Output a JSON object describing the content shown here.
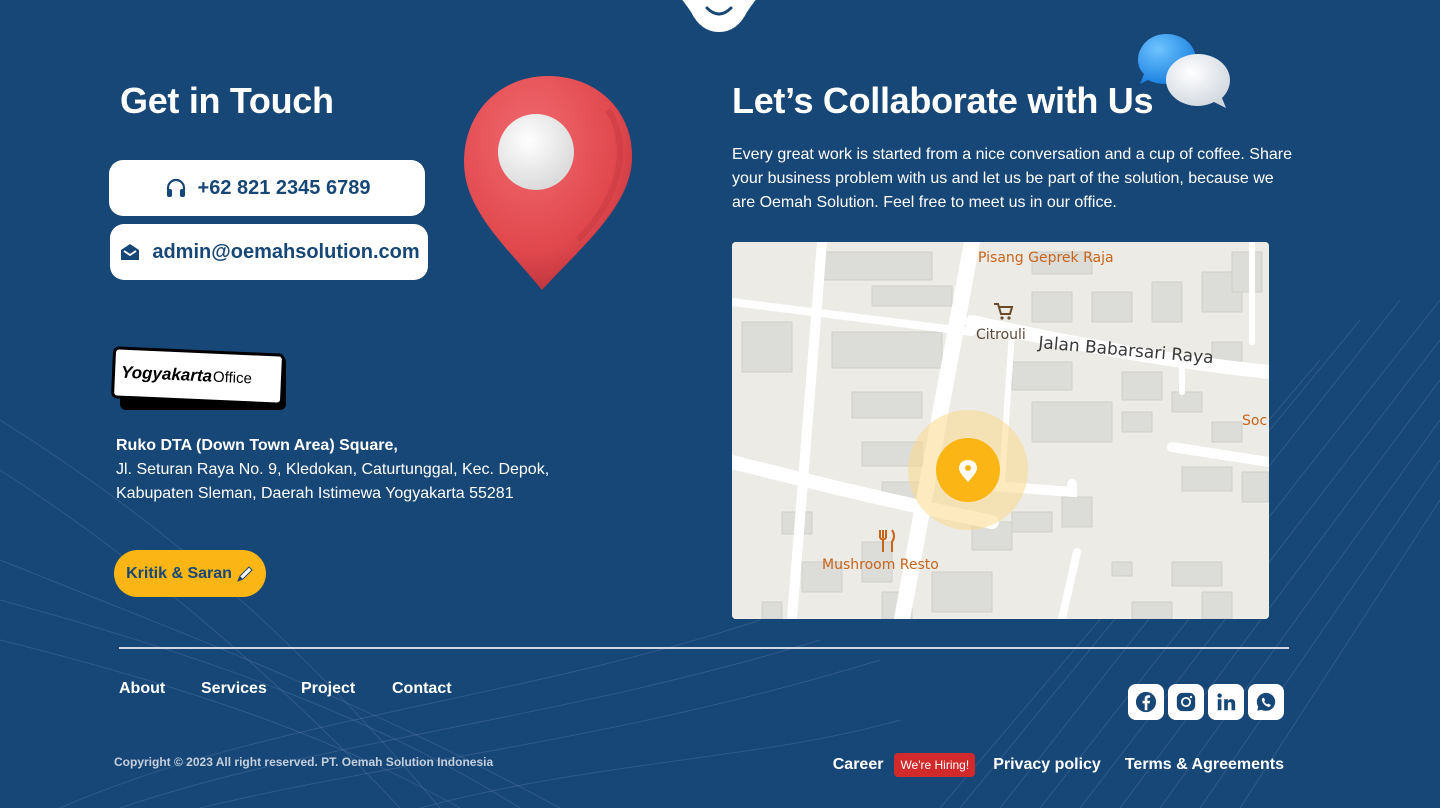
{
  "contact": {
    "heading": "Get in Touch",
    "phone": "+62 821 2345 6789",
    "email": "admin@oemahsolution.com",
    "office_badge": {
      "city": "Yogyakarta",
      "word": "Office"
    },
    "address_line1": "Ruko DTA (Down Town Area) Square,",
    "address_line2": "Jl. Seturan Raya No. 9, Kledokan, Caturtunggal, Kec. Depok,",
    "address_line3": "Kabupaten Sleman, Daerah Istimewa Yogyakarta 55281",
    "feedback_button": "Kritik & Saran"
  },
  "collab": {
    "heading": "Let’s Collaborate with Us",
    "paragraph": "Every great work is started from a nice conversation and a cup of coffee. Share your business problem with us and let us be part of the solution, because we are Oemah Solution. Feel free to meet us in our office."
  },
  "map": {
    "labels": {
      "pisang": "Pisang Geprek Raja",
      "citrouli": "Citrouli",
      "street": "Jalan Babarsari Raya",
      "soc": "Soc",
      "mushroom": "Mushroom Resto"
    },
    "colors": {
      "marker": "#fbb515",
      "poi": "#c8641a"
    }
  },
  "footer": {
    "nav": [
      "About",
      "Services",
      "Project",
      "Contact"
    ],
    "socials": [
      "facebook-icon",
      "instagram-icon",
      "linkedin-icon",
      "whatsapp-icon"
    ],
    "copyright": "Copyright © 2023 All right reserved. PT. Oemah Solution Indonesia",
    "career": "Career",
    "hiring_badge": "We're Hiring!",
    "privacy": "Privacy policy",
    "terms": "Terms & Agreements"
  },
  "theme": {
    "background": "#174777",
    "accent": "#fbb515",
    "hiring": "#d22a2a"
  }
}
